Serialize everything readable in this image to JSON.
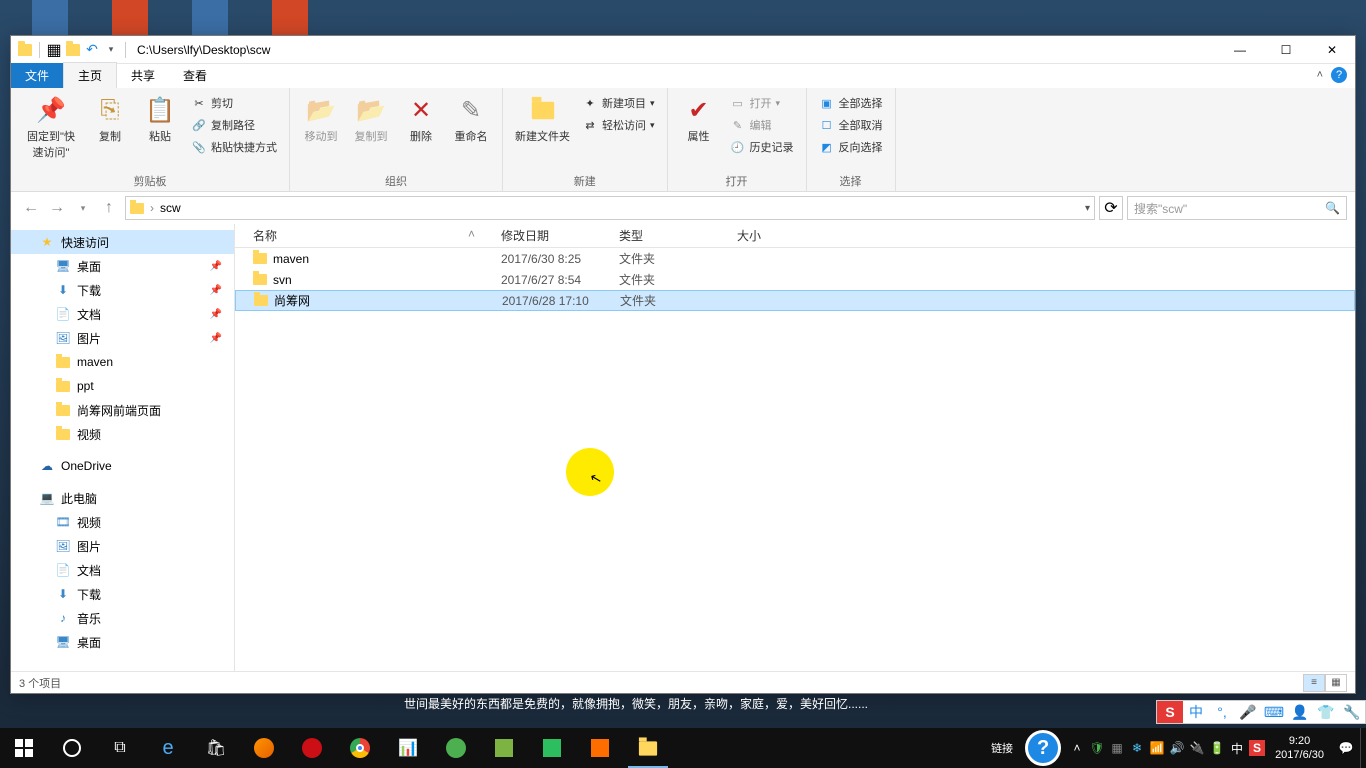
{
  "titlebar": {
    "path": "C:\\Users\\lfy\\Desktop\\scw"
  },
  "tabs": {
    "file": "文件",
    "home": "主页",
    "share": "共享",
    "view": "查看"
  },
  "ribbon": {
    "clipboard": {
      "label": "剪贴板",
      "pin": "固定到\"快速访问\"",
      "copy": "复制",
      "paste": "粘贴",
      "cut": "剪切",
      "copy_path": "复制路径",
      "paste_shortcut": "粘贴快捷方式"
    },
    "organize": {
      "label": "组织",
      "move": "移动到",
      "copyto": "复制到",
      "delete": "删除",
      "rename": "重命名"
    },
    "new": {
      "label": "新建",
      "folder": "新建文件夹",
      "item": "新建项目",
      "easy": "轻松访问"
    },
    "open": {
      "label": "打开",
      "properties": "属性",
      "openbtn": "打开",
      "edit": "编辑",
      "history": "历史记录"
    },
    "select": {
      "label": "选择",
      "all": "全部选择",
      "none": "全部取消",
      "invert": "反向选择"
    }
  },
  "addressbar": {
    "crumb": "scw"
  },
  "search": {
    "placeholder": "搜索\"scw\""
  },
  "columns": {
    "name": "名称",
    "date": "修改日期",
    "type": "类型",
    "size": "大小"
  },
  "files": [
    {
      "name": "maven",
      "date": "2017/6/30 8:25",
      "type": "文件夹",
      "size": ""
    },
    {
      "name": "svn",
      "date": "2017/6/27 8:54",
      "type": "文件夹",
      "size": ""
    },
    {
      "name": "尚筹网",
      "date": "2017/6/28 17:10",
      "type": "文件夹",
      "size": ""
    }
  ],
  "navpane": {
    "quick": "快速访问",
    "pinned": [
      "桌面",
      "下载",
      "文档",
      "图片"
    ],
    "recent": [
      "maven",
      "ppt",
      "尚筹网前端页面",
      "视频"
    ],
    "onedrive": "OneDrive",
    "thispc": "此电脑",
    "pc_items": [
      "视频",
      "图片",
      "文档",
      "下载",
      "音乐",
      "桌面"
    ]
  },
  "status": {
    "count": "3 个项目"
  },
  "quote": "世间最美好的东西都是免费的，就像拥抱，微笑，朋友，亲吻，家庭，爱，美好回忆......",
  "taskbar": {
    "link": "链接",
    "time": "9:20",
    "date": "2017/6/30"
  },
  "ime": {
    "s": "S",
    "zhong": "中"
  }
}
